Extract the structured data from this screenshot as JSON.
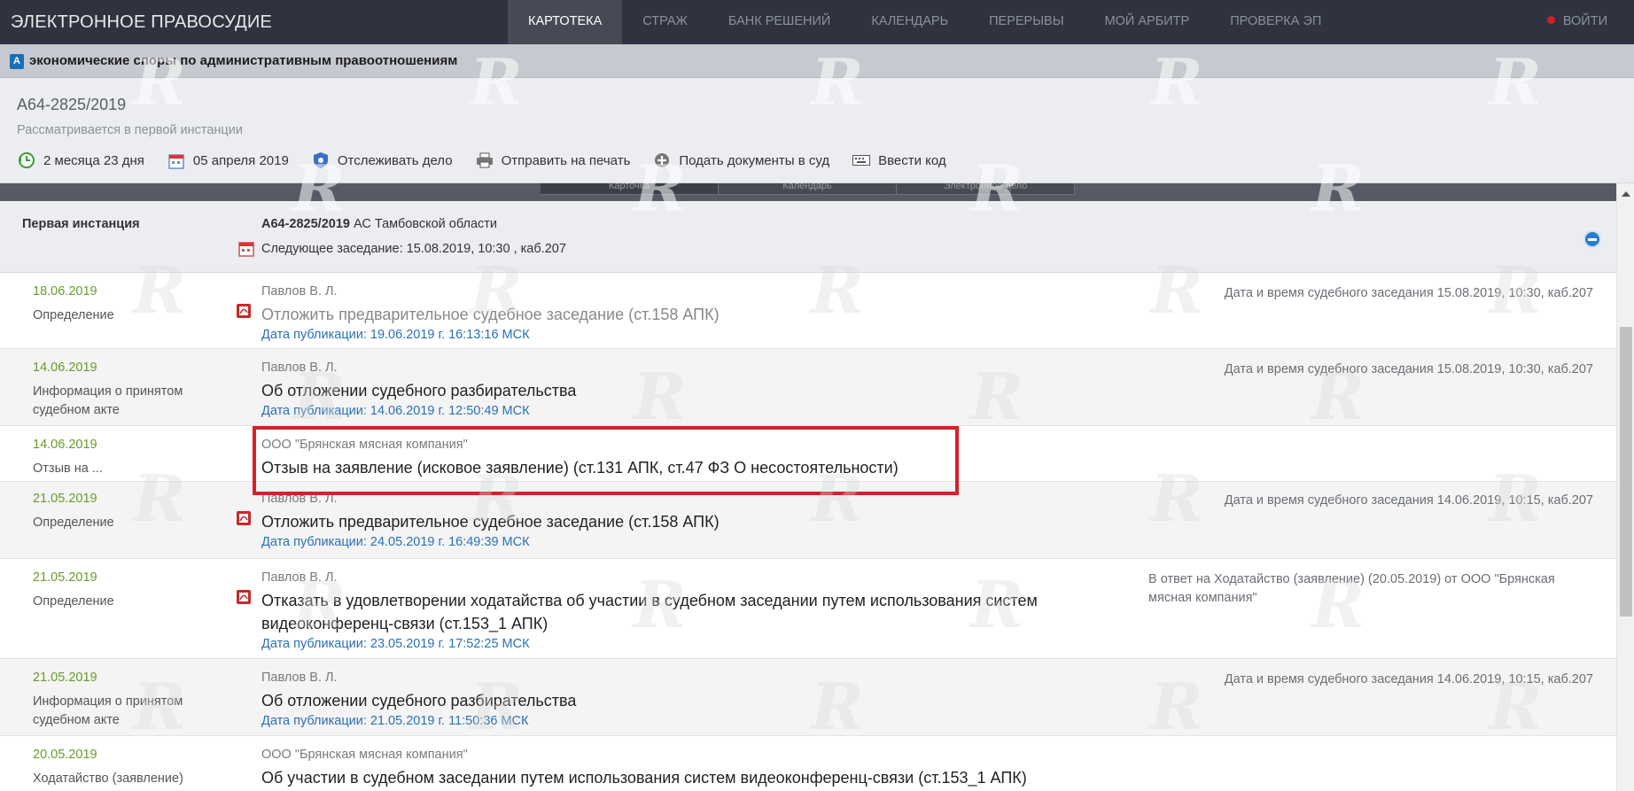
{
  "header": {
    "brand": "ЭЛЕКТРОННОЕ ПРАВОСУДИЕ",
    "nav": [
      "КАРТОТЕКА",
      "СТРАЖ",
      "БАНК РЕШЕНИЙ",
      "КАЛЕНДАРЬ",
      "ПЕРЕРЫВЫ",
      "МОЙ АРБИТР",
      "ПРОВЕРКА ЭП"
    ],
    "active_nav": "КАРТОТЕКА",
    "login": "ВОЙТИ"
  },
  "category": {
    "icon": "А",
    "label": "экономические споры по административным правоотношениям"
  },
  "case": {
    "number": "А64-2825/2019",
    "status": "Рассматривается в первой инстанции",
    "tools": {
      "duration": "2 месяца 23 дня",
      "date": "05 апреля 2019",
      "track": "Отслеживать дело",
      "print": "Отправить на печать",
      "submit": "Подать документы в суд",
      "code": "Ввести код"
    }
  },
  "tabs": [
    "Карточка",
    "Календарь",
    "Электронное дело"
  ],
  "instance": {
    "label": "Первая инстанция",
    "case_number": "А64-2825/2019",
    "court": " АС Тамбовской области",
    "next_hearing": "Следующее заседание: 15.08.2019, 10:30 , каб.207"
  },
  "documents": [
    {
      "date": "18.06.2019",
      "type": "Определение",
      "author": "Павлов В. Л.",
      "title": "Отложить предварительное судебное заседание (ст.158 АПК)",
      "publication": "Дата публикации: 19.06.2019 г. 16:13:16 МСК",
      "right": "Дата и время судебного заседания 15.08.2019, 10:30, каб.207"
    },
    {
      "date": "14.06.2019",
      "type": "Информация о принятом судебном акте",
      "author": "Павлов В. Л.",
      "title": "Об отложении судебного разбирательства",
      "publication": "Дата публикации: 14.06.2019 г. 12:50:49 МСК",
      "right": "Дата и время судебного заседания 15.08.2019, 10:30, каб.207"
    },
    {
      "date": "14.06.2019",
      "type": "Отзыв на ...",
      "author": "ООО \"Брянская мясная компания\"",
      "title": "Отзыв на заявление (исковое заявление) (ст.131 АПК, ст.47 ФЗ О несостоятельности)",
      "publication": "",
      "right": ""
    },
    {
      "date": "21.05.2019",
      "type": "Определение",
      "author": "Павлов В. Л.",
      "title": "Отложить предварительное судебное заседание (ст.158 АПК)",
      "publication": "Дата публикации: 24.05.2019 г. 16:49:39 МСК",
      "right": "Дата и время судебного заседания 14.06.2019, 10:15, каб.207"
    },
    {
      "date": "21.05.2019",
      "type": "Определение",
      "author": "Павлов В. Л.",
      "title": "Отказать в удовлетворении ходатайства об участии в судебном заседании путем использования систем видеоконференц-связи (ст.153_1 АПК)",
      "publication": "Дата публикации: 23.05.2019 г. 17:52:25 МСК",
      "right": "В ответ на Ходатайство (заявление) (20.05.2019) от ООО \"Брянская мясная компания\""
    },
    {
      "date": "21.05.2019",
      "type": "Информация о принятом судебном акте",
      "author": "Павлов В. Л.",
      "title": "Об отложении судебного разбирательства",
      "publication": "Дата публикации: 21.05.2019 г. 11:50:36 МСК",
      "right": "Дата и время судебного заседания 14.06.2019, 10:15, каб.207"
    },
    {
      "date": "20.05.2019",
      "type": "Ходатайство (заявление)",
      "author": "ООО \"Брянская мясная компания\"",
      "title": "Об участии в судебном заседании путем использования систем видеоконференц-связи (ст.153_1 АПК)",
      "publication": "",
      "right": ""
    }
  ],
  "watermark": "R",
  "colors": {
    "topbar": "#2e333f",
    "date_green": "#6a9a2e",
    "link_blue": "#2a70b7",
    "highlight_red": "#d6202a"
  }
}
